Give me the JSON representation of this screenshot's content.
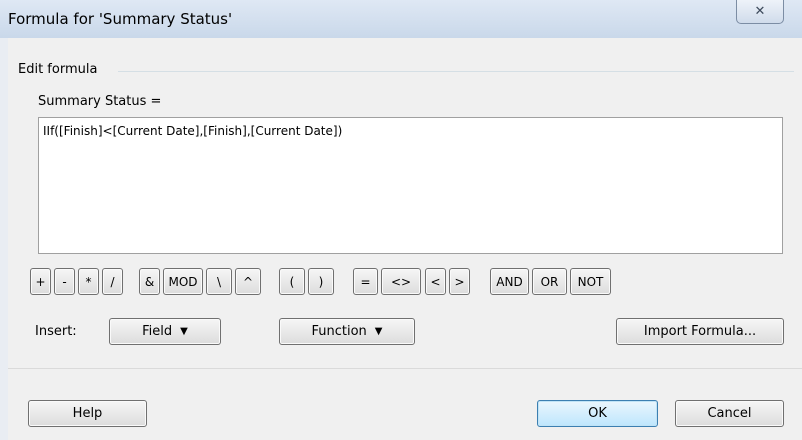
{
  "window": {
    "title": "Formula for 'Summary Status'",
    "close_glyph": "✕"
  },
  "group": {
    "label": "Edit formula"
  },
  "formula": {
    "label": "Summary Status =",
    "text": "IIf([Finish]<[Current Date],[Finish],[Current Date])"
  },
  "operators": [
    "+",
    "-",
    "*",
    "/",
    "&",
    "MOD",
    "\\",
    "^",
    "(",
    ")",
    "=",
    "<>",
    "<",
    ">",
    "AND",
    "OR",
    "NOT"
  ],
  "insert": {
    "label": "Insert:",
    "field_label": "Field",
    "function_label": "Function",
    "import_label": "Import Formula...",
    "dropdown_glyph": "▼"
  },
  "footer": {
    "help_label": "Help",
    "ok_label": "OK",
    "cancel_label": "Cancel"
  }
}
